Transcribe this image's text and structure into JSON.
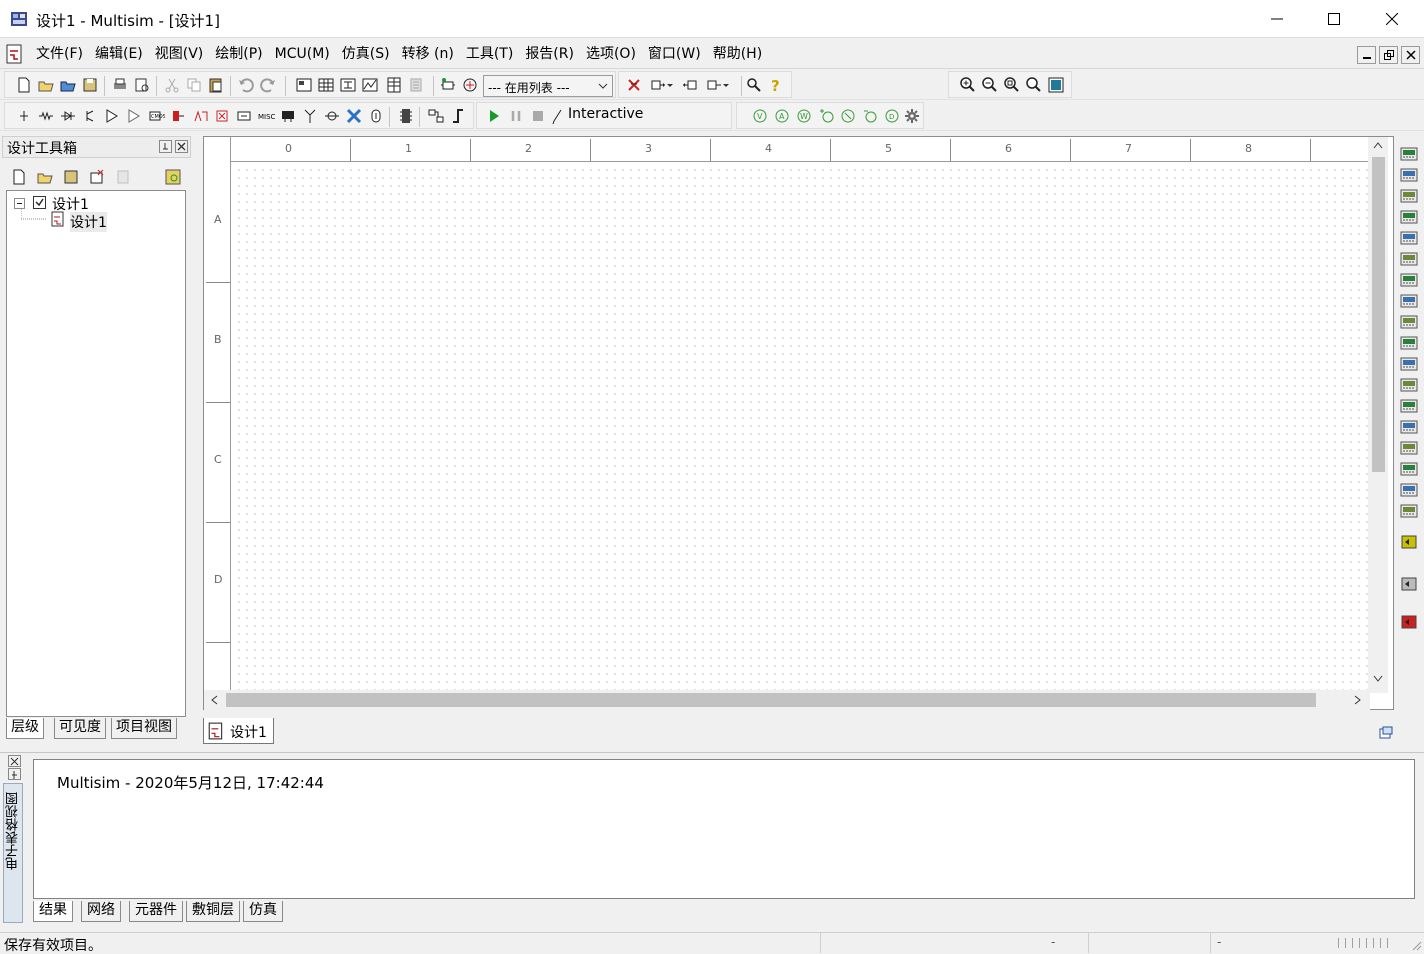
{
  "window": {
    "title": "设计1 - Multisim - [设计1]",
    "minimize_glyph": "—",
    "maximize_glyph": "☐",
    "close_glyph": "✕"
  },
  "menu": {
    "items": [
      "文件(F)",
      "编辑(E)",
      "视图(V)",
      "绘制(P)",
      "MCU(M)",
      "仿真(S)",
      "转移 (n)",
      "工具(T)",
      "报告(R)",
      "选项(O)",
      "窗口(W)",
      "帮助(H)"
    ]
  },
  "toolbar": {
    "in_use_list": "--- 在用列表 ---",
    "mode_label": "Interactive"
  },
  "design_toolbox": {
    "title": "设计工具箱",
    "tree": {
      "root": "设计1",
      "child": "设计1"
    },
    "tabs": [
      "层级",
      "可见度",
      "项目视图"
    ]
  },
  "canvas": {
    "ruler_columns": [
      "0",
      "1",
      "2",
      "3",
      "4",
      "5",
      "6",
      "7",
      "8"
    ],
    "ruler_rows": [
      "A",
      "B",
      "C",
      "D"
    ],
    "sheet_tab": "设计1"
  },
  "spreadsheet": {
    "side_label": "电子表格视图",
    "output_line": "Multisim  -  2020年5月12日, 17:42:44",
    "tabs": [
      "结果",
      "网络",
      "元器件",
      "敷铜层",
      "仿真"
    ]
  },
  "status": {
    "message": "保存有效项目。",
    "cell1": "-",
    "cell2": "-"
  },
  "colors": {
    "accent_green": "#1a9a2a",
    "accent_red": "#cc1f1f",
    "panel_header": "#ededed",
    "side_label_bg": "#dde6ef"
  }
}
